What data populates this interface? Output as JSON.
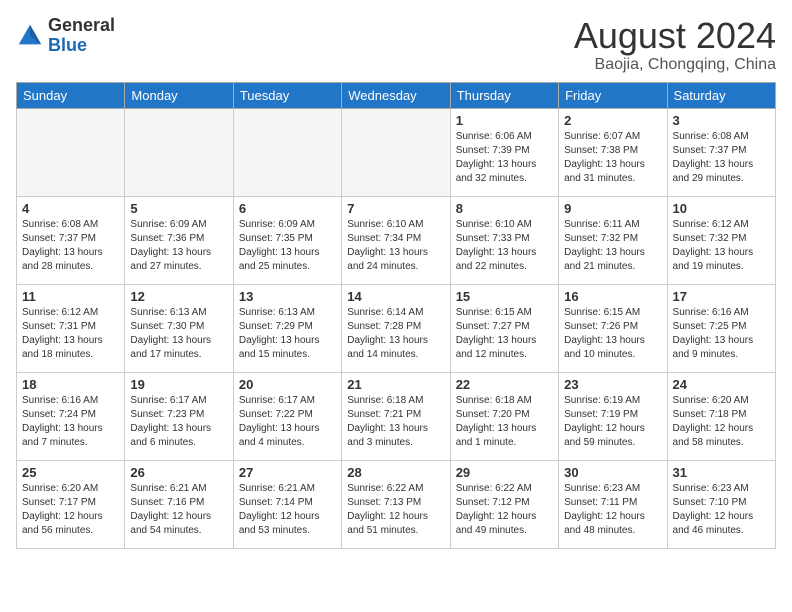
{
  "header": {
    "logo_line1": "General",
    "logo_line2": "Blue",
    "month_year": "August 2024",
    "location": "Baojia, Chongqing, China"
  },
  "weekdays": [
    "Sunday",
    "Monday",
    "Tuesday",
    "Wednesday",
    "Thursday",
    "Friday",
    "Saturday"
  ],
  "weeks": [
    [
      {
        "day": "",
        "info": ""
      },
      {
        "day": "",
        "info": ""
      },
      {
        "day": "",
        "info": ""
      },
      {
        "day": "",
        "info": ""
      },
      {
        "day": "1",
        "info": "Sunrise: 6:06 AM\nSunset: 7:39 PM\nDaylight: 13 hours\nand 32 minutes."
      },
      {
        "day": "2",
        "info": "Sunrise: 6:07 AM\nSunset: 7:38 PM\nDaylight: 13 hours\nand 31 minutes."
      },
      {
        "day": "3",
        "info": "Sunrise: 6:08 AM\nSunset: 7:37 PM\nDaylight: 13 hours\nand 29 minutes."
      }
    ],
    [
      {
        "day": "4",
        "info": "Sunrise: 6:08 AM\nSunset: 7:37 PM\nDaylight: 13 hours\nand 28 minutes."
      },
      {
        "day": "5",
        "info": "Sunrise: 6:09 AM\nSunset: 7:36 PM\nDaylight: 13 hours\nand 27 minutes."
      },
      {
        "day": "6",
        "info": "Sunrise: 6:09 AM\nSunset: 7:35 PM\nDaylight: 13 hours\nand 25 minutes."
      },
      {
        "day": "7",
        "info": "Sunrise: 6:10 AM\nSunset: 7:34 PM\nDaylight: 13 hours\nand 24 minutes."
      },
      {
        "day": "8",
        "info": "Sunrise: 6:10 AM\nSunset: 7:33 PM\nDaylight: 13 hours\nand 22 minutes."
      },
      {
        "day": "9",
        "info": "Sunrise: 6:11 AM\nSunset: 7:32 PM\nDaylight: 13 hours\nand 21 minutes."
      },
      {
        "day": "10",
        "info": "Sunrise: 6:12 AM\nSunset: 7:32 PM\nDaylight: 13 hours\nand 19 minutes."
      }
    ],
    [
      {
        "day": "11",
        "info": "Sunrise: 6:12 AM\nSunset: 7:31 PM\nDaylight: 13 hours\nand 18 minutes."
      },
      {
        "day": "12",
        "info": "Sunrise: 6:13 AM\nSunset: 7:30 PM\nDaylight: 13 hours\nand 17 minutes."
      },
      {
        "day": "13",
        "info": "Sunrise: 6:13 AM\nSunset: 7:29 PM\nDaylight: 13 hours\nand 15 minutes."
      },
      {
        "day": "14",
        "info": "Sunrise: 6:14 AM\nSunset: 7:28 PM\nDaylight: 13 hours\nand 14 minutes."
      },
      {
        "day": "15",
        "info": "Sunrise: 6:15 AM\nSunset: 7:27 PM\nDaylight: 13 hours\nand 12 minutes."
      },
      {
        "day": "16",
        "info": "Sunrise: 6:15 AM\nSunset: 7:26 PM\nDaylight: 13 hours\nand 10 minutes."
      },
      {
        "day": "17",
        "info": "Sunrise: 6:16 AM\nSunset: 7:25 PM\nDaylight: 13 hours\nand 9 minutes."
      }
    ],
    [
      {
        "day": "18",
        "info": "Sunrise: 6:16 AM\nSunset: 7:24 PM\nDaylight: 13 hours\nand 7 minutes."
      },
      {
        "day": "19",
        "info": "Sunrise: 6:17 AM\nSunset: 7:23 PM\nDaylight: 13 hours\nand 6 minutes."
      },
      {
        "day": "20",
        "info": "Sunrise: 6:17 AM\nSunset: 7:22 PM\nDaylight: 13 hours\nand 4 minutes."
      },
      {
        "day": "21",
        "info": "Sunrise: 6:18 AM\nSunset: 7:21 PM\nDaylight: 13 hours\nand 3 minutes."
      },
      {
        "day": "22",
        "info": "Sunrise: 6:18 AM\nSunset: 7:20 PM\nDaylight: 13 hours\nand 1 minute."
      },
      {
        "day": "23",
        "info": "Sunrise: 6:19 AM\nSunset: 7:19 PM\nDaylight: 12 hours\nand 59 minutes."
      },
      {
        "day": "24",
        "info": "Sunrise: 6:20 AM\nSunset: 7:18 PM\nDaylight: 12 hours\nand 58 minutes."
      }
    ],
    [
      {
        "day": "25",
        "info": "Sunrise: 6:20 AM\nSunset: 7:17 PM\nDaylight: 12 hours\nand 56 minutes."
      },
      {
        "day": "26",
        "info": "Sunrise: 6:21 AM\nSunset: 7:16 PM\nDaylight: 12 hours\nand 54 minutes."
      },
      {
        "day": "27",
        "info": "Sunrise: 6:21 AM\nSunset: 7:14 PM\nDaylight: 12 hours\nand 53 minutes."
      },
      {
        "day": "28",
        "info": "Sunrise: 6:22 AM\nSunset: 7:13 PM\nDaylight: 12 hours\nand 51 minutes."
      },
      {
        "day": "29",
        "info": "Sunrise: 6:22 AM\nSunset: 7:12 PM\nDaylight: 12 hours\nand 49 minutes."
      },
      {
        "day": "30",
        "info": "Sunrise: 6:23 AM\nSunset: 7:11 PM\nDaylight: 12 hours\nand 48 minutes."
      },
      {
        "day": "31",
        "info": "Sunrise: 6:23 AM\nSunset: 7:10 PM\nDaylight: 12 hours\nand 46 minutes."
      }
    ]
  ]
}
